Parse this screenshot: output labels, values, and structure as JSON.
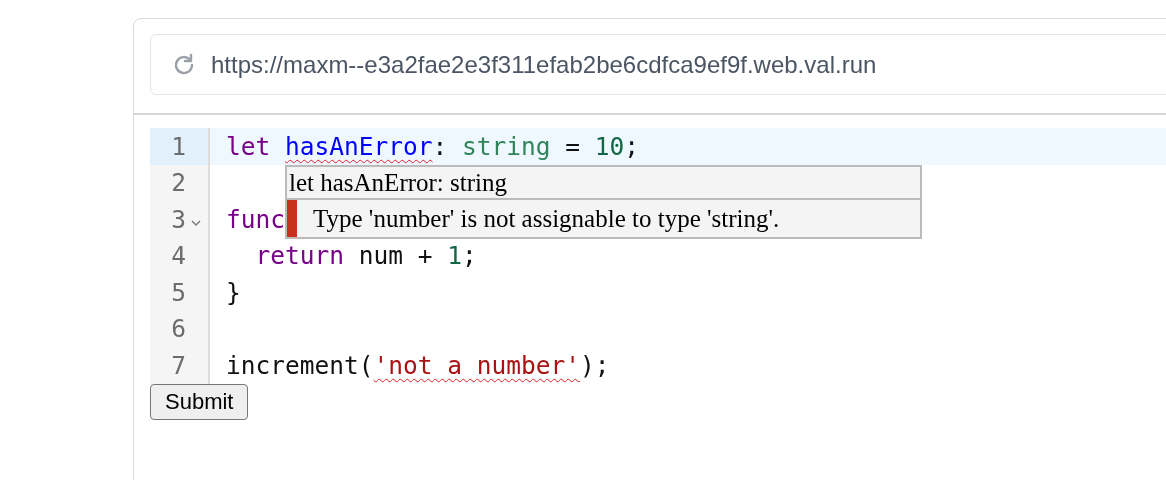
{
  "address_bar": {
    "url": "https://maxm--e3a2fae2e3f311efab2be6cdfca9ef9f.web.val.run"
  },
  "editor": {
    "lines": [
      {
        "number": "1",
        "active": true,
        "foldable": false,
        "tokens": [
          {
            "text": "let ",
            "kind": "keyword",
            "error": false
          },
          {
            "text": "hasAnError",
            "kind": "variable",
            "error": true
          },
          {
            "text": ": ",
            "kind": "plain",
            "error": false
          },
          {
            "text": "string",
            "kind": "type",
            "error": false
          },
          {
            "text": " = ",
            "kind": "plain",
            "error": false
          },
          {
            "text": "10",
            "kind": "number",
            "error": false
          },
          {
            "text": ";",
            "kind": "plain",
            "error": false
          }
        ]
      },
      {
        "number": "2",
        "active": false,
        "foldable": false
      },
      {
        "number": "3",
        "active": false,
        "foldable": true,
        "tokens": [
          {
            "text": "func",
            "kind": "keyword",
            "error": false
          }
        ]
      },
      {
        "number": "4",
        "active": false,
        "foldable": false,
        "tokens": [
          {
            "text": "  return",
            "kind": "keyword",
            "error": false
          },
          {
            "text": " num + ",
            "kind": "plain",
            "error": false
          },
          {
            "text": "1",
            "kind": "number",
            "error": false
          },
          {
            "text": ";",
            "kind": "plain",
            "error": false
          }
        ]
      },
      {
        "number": "5",
        "active": false,
        "foldable": false,
        "tokens": [
          {
            "text": "}",
            "kind": "plain",
            "error": false
          }
        ]
      },
      {
        "number": "6",
        "active": false,
        "foldable": false
      },
      {
        "number": "7",
        "active": false,
        "foldable": false,
        "tokens": [
          {
            "text": "increment(",
            "kind": "plain",
            "error": false
          },
          {
            "text": "'not a number'",
            "kind": "string",
            "error": true
          },
          {
            "text": ");",
            "kind": "plain",
            "error": false
          }
        ]
      }
    ],
    "tooltip": {
      "title": "let hasAnError: string",
      "message": "Type 'number' is not assignable to type 'string'."
    }
  },
  "submit_button": {
    "label": "Submit"
  }
}
